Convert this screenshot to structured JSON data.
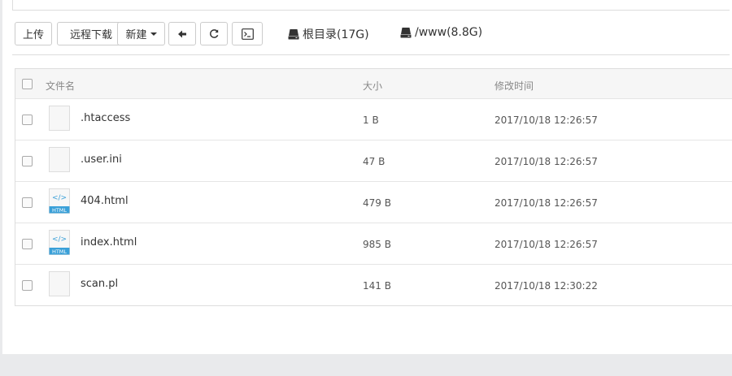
{
  "toolbar": {
    "upload_label": "上传",
    "remote_download_label": "远程下载",
    "new_label": "新建",
    "back_icon": "arrow-left-icon",
    "refresh_icon": "refresh-icon",
    "terminal_icon": "terminal-icon"
  },
  "disks": [
    {
      "label": "根目录(17G)"
    },
    {
      "label": "/www(8.8G)"
    }
  ],
  "table": {
    "columns": {
      "name": "文件名",
      "size": "大小",
      "modified": "修改时间"
    },
    "rows": [
      {
        "name": ".htaccess",
        "size": "1 B",
        "modified": "2017/10/18 12:26:57",
        "type": "file"
      },
      {
        "name": ".user.ini",
        "size": "47 B",
        "modified": "2017/10/18 12:26:57",
        "type": "file"
      },
      {
        "name": "404.html",
        "size": "479 B",
        "modified": "2017/10/18 12:26:57",
        "type": "html"
      },
      {
        "name": "index.html",
        "size": "985 B",
        "modified": "2017/10/18 12:26:57",
        "type": "html"
      },
      {
        "name": "scan.pl",
        "size": "141 B",
        "modified": "2017/10/18 12:30:22",
        "type": "file"
      }
    ],
    "html_badge": "HTML",
    "html_glyph": "</>"
  },
  "colors": {
    "html_icon": "#3aa0d8"
  }
}
